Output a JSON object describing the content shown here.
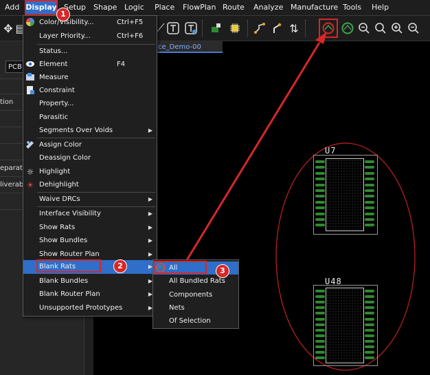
{
  "menubar": {
    "items": [
      "Add",
      "Display",
      "Setup",
      "Shape",
      "Logic",
      "Place",
      "FlowPlan",
      "Route",
      "Analyze",
      "Manufacture",
      "Tools",
      "Help"
    ],
    "active": "Display"
  },
  "left_panel": {
    "pcb_label": "PCB",
    "rows": [
      "tion",
      "eparatio",
      "liverab"
    ]
  },
  "document_tab": "ce_Demo-00",
  "display_menu": {
    "items": [
      {
        "label": "Color/Visibility...",
        "shortcut": "Ctrl+F5",
        "icon": "color-wheel-icon"
      },
      {
        "label": "Layer Priority...",
        "shortcut": "Ctrl+F6"
      },
      {
        "label": "Status..."
      },
      {
        "label": "Element",
        "shortcut": "F4",
        "icon": "eye-icon"
      },
      {
        "label": "Measure",
        "icon": "measure-icon"
      },
      {
        "label": "Constraint",
        "icon": "constraint-icon"
      },
      {
        "label": "Property..."
      },
      {
        "label": "Parasitic"
      },
      {
        "label": "Segments Over Voids",
        "submenu": true
      },
      {
        "label": "Assign Color",
        "icon": "palette-icon"
      },
      {
        "label": "Deassign Color"
      },
      {
        "label": "Highlight",
        "icon": "highlight-icon"
      },
      {
        "label": "Dehighlight",
        "icon": "dehighlight-icon"
      },
      {
        "label": "Waive DRCs",
        "submenu": true
      },
      {
        "label": "Interface Visibility",
        "submenu": true
      },
      {
        "label": "Show Rats",
        "submenu": true
      },
      {
        "label": "Show Bundles",
        "submenu": true
      },
      {
        "label": "Show Router Plan",
        "submenu": true
      },
      {
        "label": "Blank Rats",
        "submenu": true
      },
      {
        "label": "Blank Bundles",
        "submenu": true
      },
      {
        "label": "Blank Router Plan",
        "submenu": true
      },
      {
        "label": "Unsupported Prototypes",
        "submenu": true
      }
    ]
  },
  "blank_rats_submenu": {
    "items": [
      "All",
      "All Bundled Rats",
      "Components",
      "Nets",
      "Of Selection"
    ]
  },
  "callouts": [
    "1",
    "2",
    "3"
  ],
  "components": [
    {
      "ref": "U7"
    },
    {
      "ref": "U48"
    }
  ],
  "colors": {
    "accent_blue": "#2f6ec9",
    "annotation_red": "#d62828",
    "pin_green": "#2f8a2f",
    "canvas": "#000000"
  }
}
